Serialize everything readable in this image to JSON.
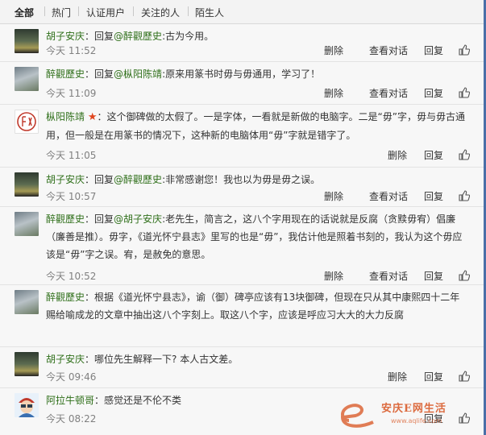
{
  "tabs": [
    "全部",
    "热门",
    "认证用户",
    "关注的人",
    "陌生人"
  ],
  "actions": {
    "delete": "删除",
    "view_dialog": "查看对话",
    "reply": "回复"
  },
  "comments": [
    {
      "user": "胡子安庆",
      "reply_prefix": "回复",
      "mention": "@醉觀歷史",
      "text": ":古为今用。",
      "time": "今天 11:52"
    },
    {
      "user": "醉觀歷史",
      "reply_prefix": "回复",
      "mention": "@枞阳陈靖",
      "text": ":原来用篆书时毋与毋通用，学习了！",
      "time": "今天 11:09"
    },
    {
      "user": "枞阳陈靖",
      "line1": "这个御碑做的太假了。一是字体，一看就是新做的电脑字。二是“毋”字，毋与毋古通",
      "line2": "用，但一般是在用篆书的情况下，这种新的电脑体用“毋”字就是错字了。",
      "time": "今天 11:05"
    },
    {
      "user": "胡子安庆",
      "reply_prefix": "回复",
      "mention": "@醉觀歷史",
      "text": ":非常感谢您！我也以为毋是毋之误。",
      "time": "今天 10:57"
    },
    {
      "user": "醉觀歷史",
      "reply_prefix": "回复",
      "mention": "@胡子安庆",
      "line1": ":老先生，简言之，这八个字用现在的话说就是反腐（贪黩毋宥）倡廉",
      "line2": "（廉善是推）。毋字，《道光怀宁县志》里写的也是“毋”，我估计他是照着书刻的，我认为这个毋应",
      "line3": "该是“毋”字之误。宥，是赦免的意思。",
      "time": "今天 10:52"
    },
    {
      "user": "醉觀歷史",
      "line1": "根据《道光怀宁县志》，谕（御）碑亭应该有13块御碑，但现在只从其中康熙四十二年",
      "line2": "赐给喻成龙的文章中抽出这八个字刻上。取这八个字，应该是呼应习大大的大力反腐"
    },
    {
      "user": "胡子安庆",
      "text": "哪位先生解释一下? 本人古文差。",
      "time": "今天 09:46"
    },
    {
      "user": "阿拉牛顿哥",
      "text": "感觉还是不伦不类",
      "time": "今天 08:22"
    }
  ],
  "watermark": {
    "brand": "安庆E网生活",
    "url": "www.aqlife.com"
  },
  "colors": {
    "username": "#2f6f1a",
    "star": "#e0461f",
    "tab_bg": "#f3f3f3",
    "item_bg": "#f7f7f7"
  }
}
